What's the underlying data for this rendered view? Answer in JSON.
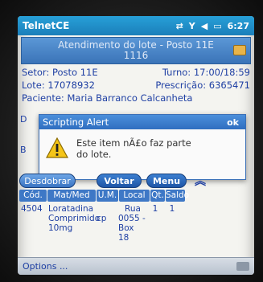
{
  "titlebar": {
    "app_title": "TelnetCE",
    "time": "6:27"
  },
  "banner": {
    "line1": "Atendimento do lote - Posto 11E",
    "line2": "1116"
  },
  "info": {
    "setor_label": "Setor:",
    "setor_value": "Posto 11E",
    "turno_label": "Turno:",
    "turno_value": "17:00/18:59",
    "lote_label": "Lote:",
    "lote_value": "17078932",
    "prescricao_label": "Prescrição:",
    "prescricao_value": "6365471",
    "paciente_label": "Paciente:",
    "paciente_value": "Maria Barranco Calcanheta",
    "partial_d": "D",
    "partial_b": "B"
  },
  "alert": {
    "title": "Scripting Alert",
    "ok_label": "ok",
    "message_line1": "Este item nÃ£o faz parte",
    "message_line2": "do lote."
  },
  "buttons": {
    "desdobrar": "Desdobrar",
    "voltar": "Voltar",
    "menu": "Menu"
  },
  "table": {
    "headers": [
      "Cód.",
      "Mat/Med",
      "U.M.",
      "Local",
      "Qt.",
      "Saldo"
    ],
    "row": {
      "cod": "4504",
      "mat_line1": "Loratadina",
      "mat_line2": "Comprimido",
      "mat_line3": "10mg",
      "um": "cp",
      "local_line1": "Rua",
      "local_line2": "0055 -",
      "local_line3": "Box 18",
      "qt": "1",
      "saldo": "1"
    }
  },
  "bottombar": {
    "options_label": "Options ..."
  },
  "colors": {
    "accent": "#1b7fba",
    "text_blue": "#1e3fa3"
  }
}
